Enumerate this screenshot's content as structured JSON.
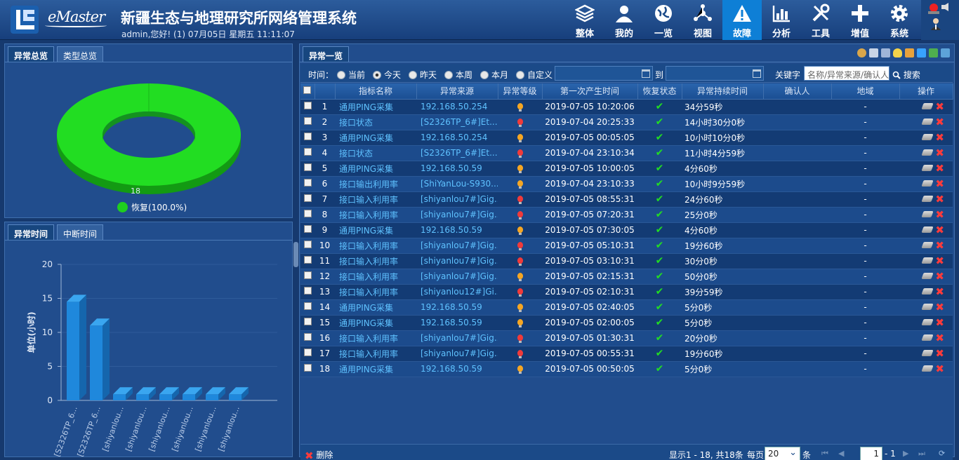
{
  "header": {
    "brand": "eMaster",
    "title": "新疆生态与地理研究所网络管理系统",
    "user_line": "admin,您好! (1) 07月05日 星期五 11:11:07"
  },
  "nav": [
    {
      "label": "整体",
      "icon": "layers-icon"
    },
    {
      "label": "我的",
      "icon": "user-icon"
    },
    {
      "label": "一览",
      "icon": "globe-icon"
    },
    {
      "label": "视图",
      "icon": "topology-icon"
    },
    {
      "label": "故障",
      "icon": "warning-icon",
      "active": true
    },
    {
      "label": "分析",
      "icon": "bar-chart-icon"
    },
    {
      "label": "工具",
      "icon": "tools-icon"
    },
    {
      "label": "增值",
      "icon": "plus-icon"
    },
    {
      "label": "系统",
      "icon": "gear-icon"
    }
  ],
  "left_top": {
    "tabs": [
      "异常总览",
      "类型总览"
    ],
    "active_tab": 0,
    "donut_value": "18",
    "legend_label": "恢复(100.0%)",
    "legend_color": "#1fce1f"
  },
  "left_bottom": {
    "tabs": [
      "异常时间",
      "中断时间"
    ],
    "active_tab": 0
  },
  "chart_data": {
    "type": "bar",
    "title": "",
    "xlabel": "",
    "ylabel": "单位(小时)",
    "ylim": [
      0,
      20
    ],
    "yticks": [
      "0",
      "5",
      "10",
      "15",
      "20"
    ],
    "categories": [
      "[S2326TP_6...",
      "[S2326TP_6...",
      "[shiyanlou...",
      "[shiyanlou...",
      "[shiyanlou...",
      "[shiyanlou...",
      "[shiyanlou...",
      "[shiyanlou..."
    ],
    "values": [
      14.5,
      11,
      0.9,
      0.9,
      0.9,
      0.9,
      0.9,
      0.9
    ],
    "color": "#1f88dc"
  },
  "main": {
    "tab": "异常一览",
    "filter": {
      "time_label": "时间：",
      "options": [
        "当前",
        "今天",
        "昨天",
        "本周",
        "本月",
        "自定义"
      ],
      "selected": 1,
      "to_label": "到",
      "keyword_label": "关键字",
      "keyword_placeholder": "名称/异常来源/确认人",
      "search_label": "搜索"
    },
    "columns": [
      "指标名称",
      "异常来源",
      "异常等级",
      "第一次产生时间",
      "恢复状态",
      "异常持续时间",
      "确认人",
      "地域",
      "操作"
    ],
    "rows": [
      {
        "no": "1",
        "name": "通用PING采集",
        "source": "192.168.50.254",
        "level": "orange",
        "time": "2019-07-05 10:20:06",
        "duration": "34分59秒",
        "confirm": "",
        "region": "-"
      },
      {
        "no": "2",
        "name": "接口状态",
        "source": "[S2326TP_6#]Et...",
        "level": "red",
        "time": "2019-07-04 20:25:33",
        "duration": "14小时30分0秒",
        "confirm": "",
        "region": "-"
      },
      {
        "no": "3",
        "name": "通用PING采集",
        "source": "192.168.50.254",
        "level": "orange",
        "time": "2019-07-05 00:05:05",
        "duration": "10小时10分0秒",
        "confirm": "",
        "region": "-"
      },
      {
        "no": "4",
        "name": "接口状态",
        "source": "[S2326TP_6#]Et...",
        "level": "red",
        "time": "2019-07-04 23:10:34",
        "duration": "11小时4分59秒",
        "confirm": "",
        "region": "-"
      },
      {
        "no": "5",
        "name": "通用PING采集",
        "source": "192.168.50.59",
        "level": "orange",
        "time": "2019-07-05 10:00:05",
        "duration": "4分60秒",
        "confirm": "",
        "region": "-"
      },
      {
        "no": "6",
        "name": "接口输出利用率",
        "source": "[ShiYanLou-S930...",
        "level": "orange",
        "time": "2019-07-04 23:10:33",
        "duration": "10小时9分59秒",
        "confirm": "",
        "region": "-"
      },
      {
        "no": "7",
        "name": "接口输入利用率",
        "source": "[shiyanlou7#]Gig...",
        "level": "red",
        "time": "2019-07-05 08:55:31",
        "duration": "24分60秒",
        "confirm": "",
        "region": "-"
      },
      {
        "no": "8",
        "name": "接口输入利用率",
        "source": "[shiyanlou7#]Gig...",
        "level": "red",
        "time": "2019-07-05 07:20:31",
        "duration": "25分0秒",
        "confirm": "",
        "region": "-"
      },
      {
        "no": "9",
        "name": "通用PING采集",
        "source": "192.168.50.59",
        "level": "orange",
        "time": "2019-07-05 07:30:05",
        "duration": "4分60秒",
        "confirm": "",
        "region": "-"
      },
      {
        "no": "10",
        "name": "接口输入利用率",
        "source": "[shiyanlou7#]Gig...",
        "level": "red",
        "time": "2019-07-05 05:10:31",
        "duration": "19分60秒",
        "confirm": "",
        "region": "-"
      },
      {
        "no": "11",
        "name": "接口输入利用率",
        "source": "[shiyanlou7#]Gig...",
        "level": "red",
        "time": "2019-07-05 03:10:31",
        "duration": "30分0秒",
        "confirm": "",
        "region": "-"
      },
      {
        "no": "12",
        "name": "接口输入利用率",
        "source": "[shiyanlou7#]Gig...",
        "level": "orange",
        "time": "2019-07-05 02:15:31",
        "duration": "50分0秒",
        "confirm": "",
        "region": "-"
      },
      {
        "no": "13",
        "name": "接口输入利用率",
        "source": "[shiyanlou12#]Gi...",
        "level": "red",
        "time": "2019-07-05 02:10:31",
        "duration": "39分59秒",
        "confirm": "",
        "region": "-"
      },
      {
        "no": "14",
        "name": "通用PING采集",
        "source": "192.168.50.59",
        "level": "orange",
        "time": "2019-07-05 02:40:05",
        "duration": "5分0秒",
        "confirm": "",
        "region": "-"
      },
      {
        "no": "15",
        "name": "通用PING采集",
        "source": "192.168.50.59",
        "level": "orange",
        "time": "2019-07-05 02:00:05",
        "duration": "5分0秒",
        "confirm": "",
        "region": "-"
      },
      {
        "no": "16",
        "name": "接口输入利用率",
        "source": "[shiyanlou7#]Gig...",
        "level": "red",
        "time": "2019-07-05 01:30:31",
        "duration": "20分0秒",
        "confirm": "",
        "region": "-"
      },
      {
        "no": "17",
        "name": "接口输入利用率",
        "source": "[shiyanlou7#]Gig...",
        "level": "red",
        "time": "2019-07-05 00:55:31",
        "duration": "19分60秒",
        "confirm": "",
        "region": "-"
      },
      {
        "no": "18",
        "name": "通用PING采集",
        "source": "192.168.50.59",
        "level": "orange",
        "time": "2019-07-05 00:50:05",
        "duration": "5分0秒",
        "confirm": "",
        "region": "-"
      }
    ],
    "level_colors": {
      "orange": "#f5a623",
      "red": "#f03a3a"
    },
    "footer": {
      "delete_label": "删除",
      "summary": "显示1 - 18, 共18条",
      "per_page_label": "每页",
      "per_page": "20",
      "unit": "条",
      "page": "1",
      "total_pages": "- 1"
    }
  }
}
